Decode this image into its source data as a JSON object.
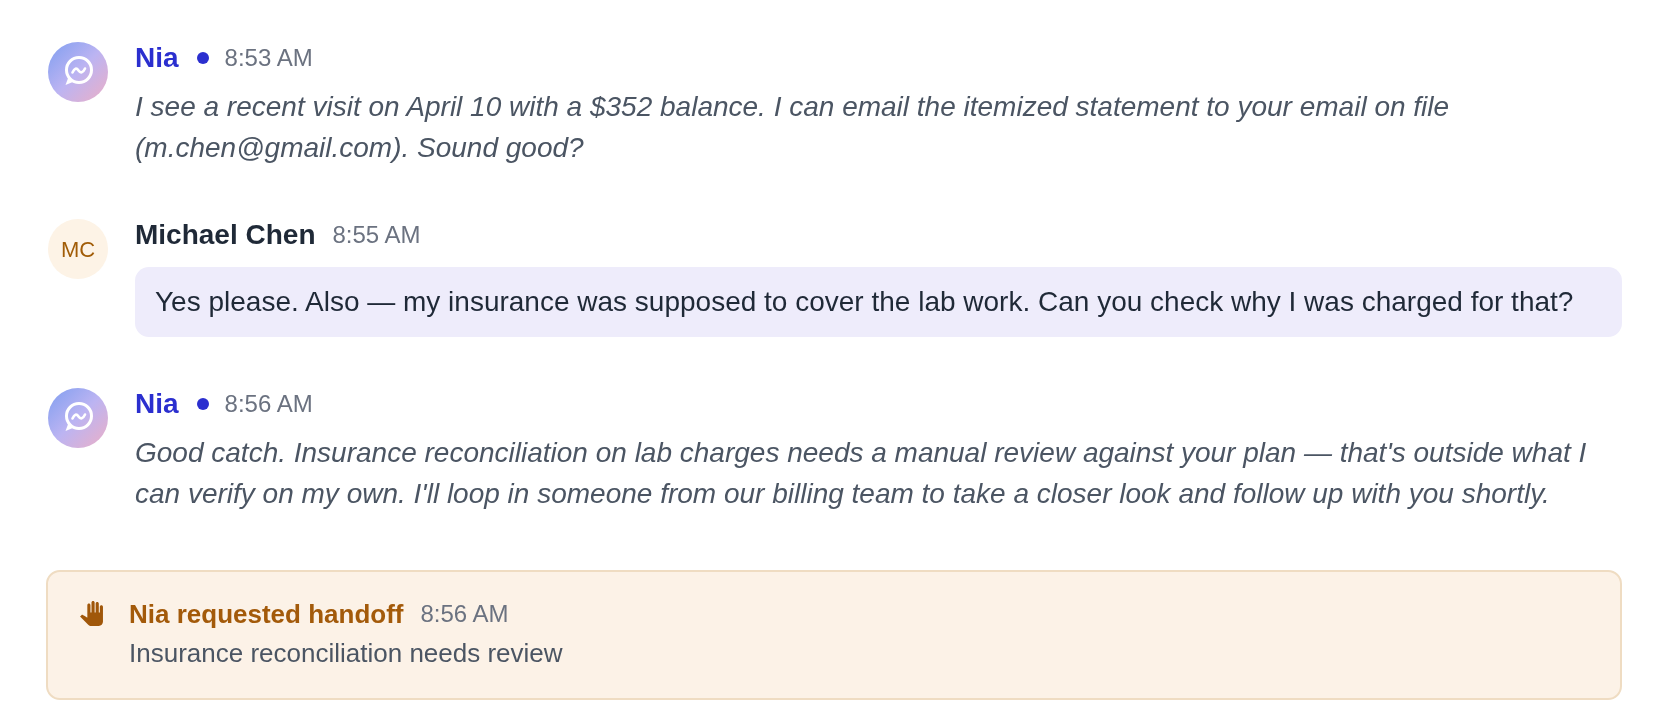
{
  "messages": [
    {
      "kind": "agent",
      "author": "Nia",
      "online": true,
      "time": "8:53 AM",
      "text": "I see a recent visit on April 10 with a $352 balance. I can email the itemized statement to your email on file (m.chen@gmail.com). Sound good?"
    },
    {
      "kind": "user",
      "author": "Michael Chen",
      "initials": "MC",
      "time": "8:55 AM",
      "text": "Yes please. Also — my insurance was supposed to cover the lab work. Can you check why I was charged for that?"
    },
    {
      "kind": "agent",
      "author": "Nia",
      "online": true,
      "time": "8:56 AM",
      "text": "Good catch. Insurance reconciliation on lab charges needs a manual review against your plan — that's outside what I can verify on my own. I'll loop in someone from our billing team to take a closer look and follow up with you shortly."
    }
  ],
  "handoff": {
    "title": "Nia requested handoff",
    "time": "8:56 AM",
    "reason": "Insurance reconciliation needs review"
  }
}
